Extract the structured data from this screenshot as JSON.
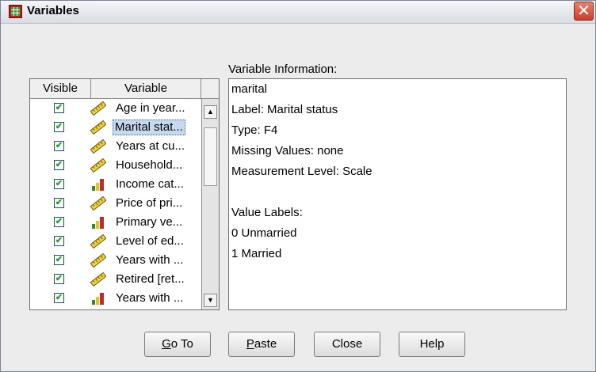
{
  "window": {
    "title": "Variables",
    "close_glyph": "✕"
  },
  "variable_list": {
    "headers": {
      "visible": "Visible",
      "variable": "Variable"
    },
    "rows": [
      {
        "label": "Age in year...",
        "type_icon": "scale-ruler-icon",
        "visible": true,
        "selected": false
      },
      {
        "label": "Marital stat...",
        "type_icon": "scale-ruler-icon",
        "visible": true,
        "selected": true
      },
      {
        "label": "Years at cu...",
        "type_icon": "scale-ruler-icon",
        "visible": true,
        "selected": false
      },
      {
        "label": "Household...",
        "type_icon": "scale-ruler-icon",
        "visible": true,
        "selected": false
      },
      {
        "label": "Income cat...",
        "type_icon": "ordinal-bars-icon",
        "visible": true,
        "selected": false
      },
      {
        "label": "Price of pri...",
        "type_icon": "scale-ruler-icon",
        "visible": true,
        "selected": false
      },
      {
        "label": "Primary ve...",
        "type_icon": "ordinal-bars-icon",
        "visible": true,
        "selected": false
      },
      {
        "label": "Level of ed...",
        "type_icon": "scale-ruler-icon",
        "visible": true,
        "selected": false
      },
      {
        "label": "Years with ...",
        "type_icon": "scale-ruler-icon",
        "visible": true,
        "selected": false
      },
      {
        "label": "Retired [ret...",
        "type_icon": "scale-ruler-icon",
        "visible": true,
        "selected": false
      },
      {
        "label": "Years with ...",
        "type_icon": "ordinal-bars-icon",
        "visible": true,
        "selected": false
      }
    ]
  },
  "info": {
    "section_label": "Variable Information:",
    "lines": [
      "marital",
      "Label:  Marital status",
      "Type:  F4",
      "Missing Values:  none",
      "Measurement Level:  Scale",
      "",
      "Value Labels:",
      "0 Unmarried",
      "1 Married"
    ]
  },
  "buttons": {
    "goto": {
      "mnemonic": "G",
      "rest": "o To"
    },
    "paste": {
      "mnemonic": "P",
      "rest": "aste"
    },
    "close": "Close",
    "help": "Help"
  },
  "colors": {
    "selection_bg": "#c6d9ee",
    "check_green": "#21a121",
    "close_red": "#c8412a"
  }
}
